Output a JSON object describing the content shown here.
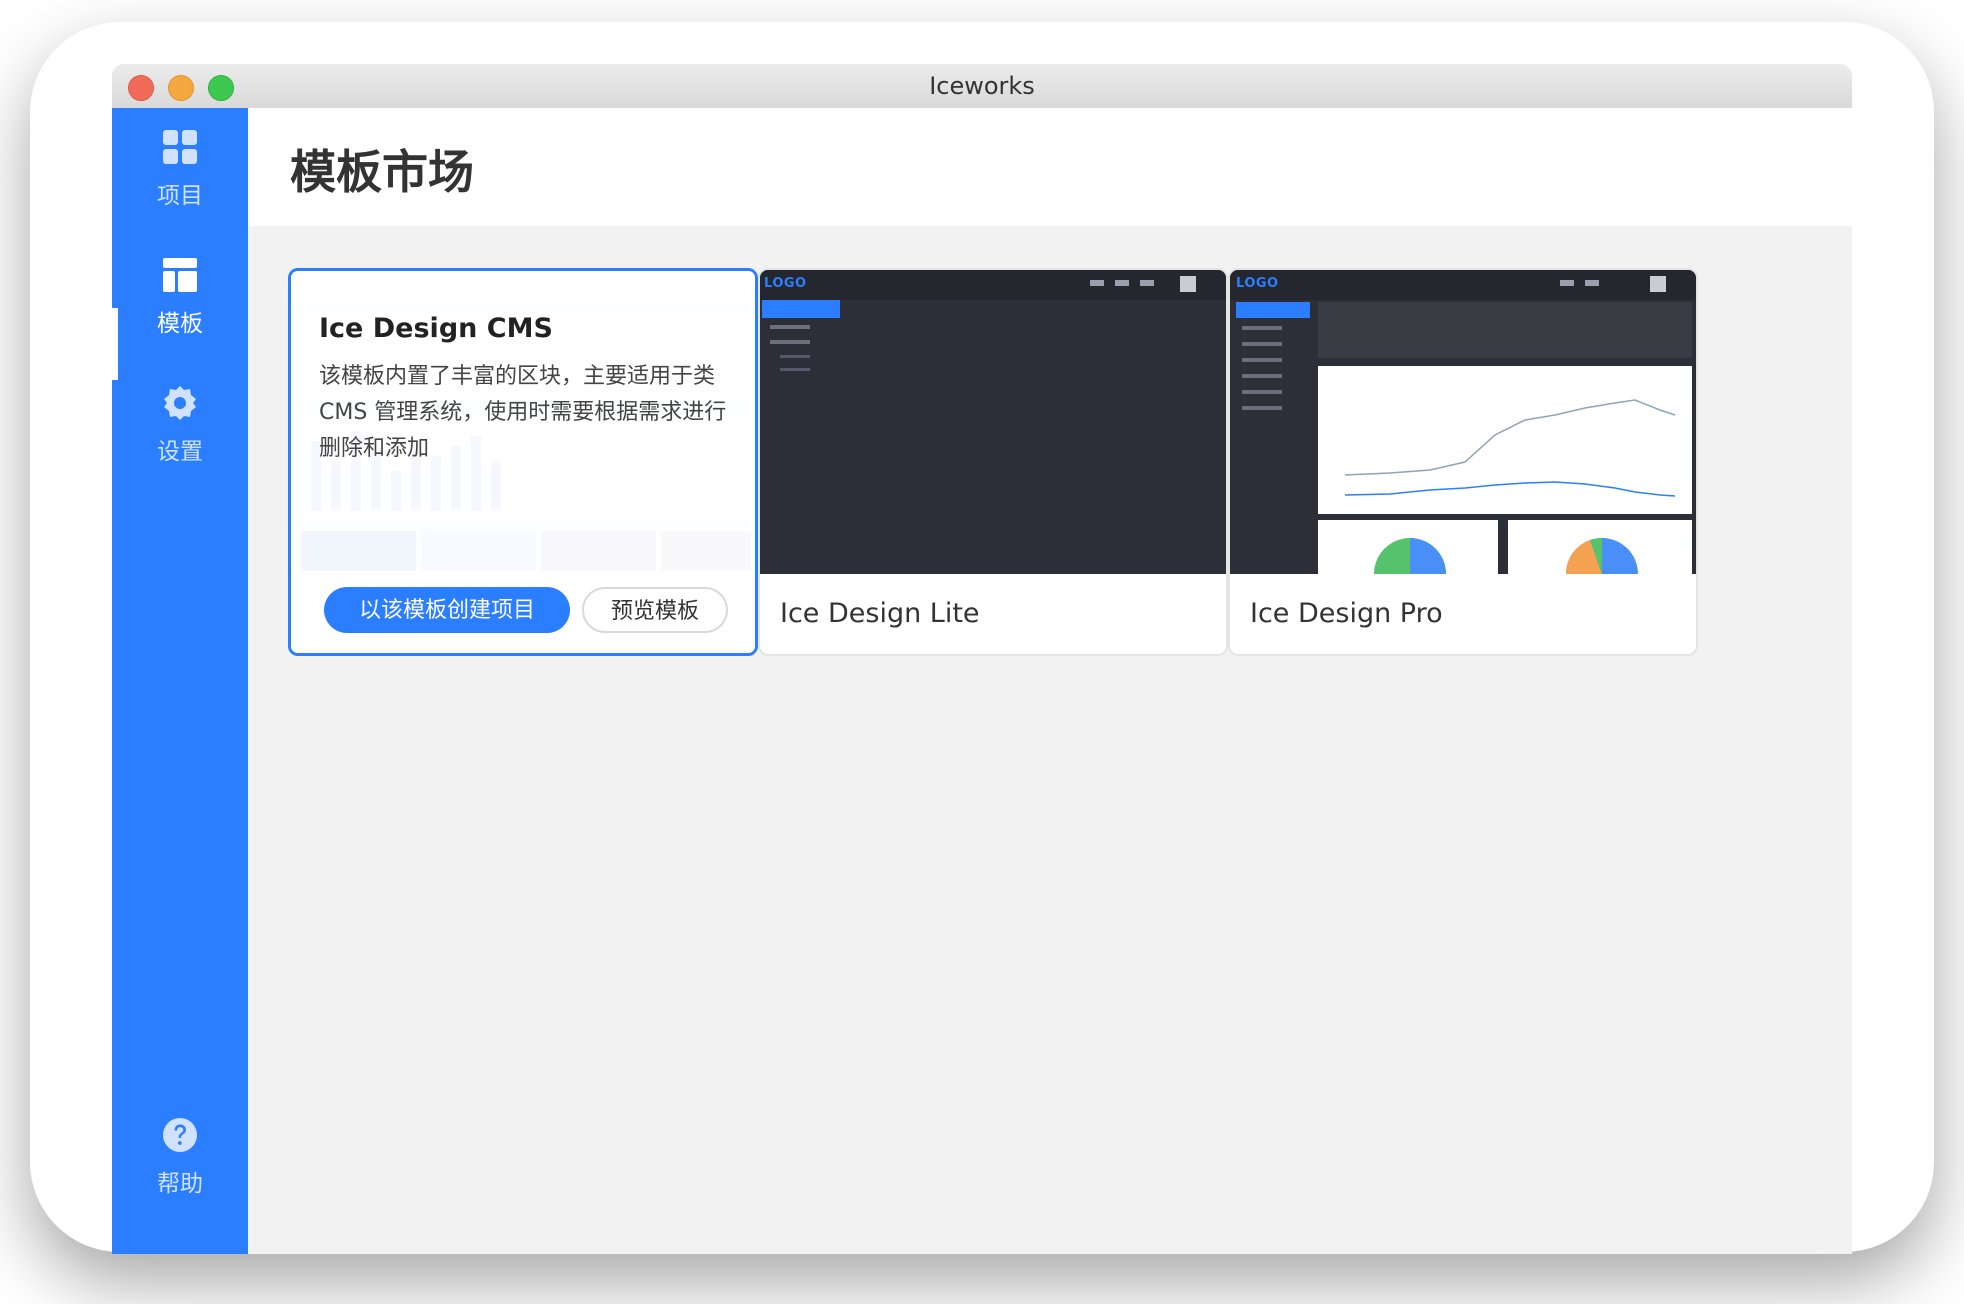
{
  "window": {
    "title": "Iceworks"
  },
  "sidebar": {
    "items": [
      {
        "label": "项目",
        "icon": "grid-icon"
      },
      {
        "label": "模板",
        "icon": "layout-icon"
      },
      {
        "label": "设置",
        "icon": "gear-icon"
      }
    ],
    "help": {
      "label": "帮助",
      "icon": "question-icon"
    },
    "accent": "#2a7eff"
  },
  "page": {
    "title": "模板市场"
  },
  "templates": [
    {
      "name": "Ice Design CMS",
      "description": "该模板内置了丰富的区块，主要适用于类 CMS 管理系统，使用时需要根据需求进行删除和添加",
      "create_label": "以该模板创建项目",
      "preview_label": "预览模板",
      "selected": true
    },
    {
      "name": "Ice Design Lite",
      "logo": "LOGO"
    },
    {
      "name": "Ice Design Pro",
      "logo": "LOGO"
    }
  ]
}
